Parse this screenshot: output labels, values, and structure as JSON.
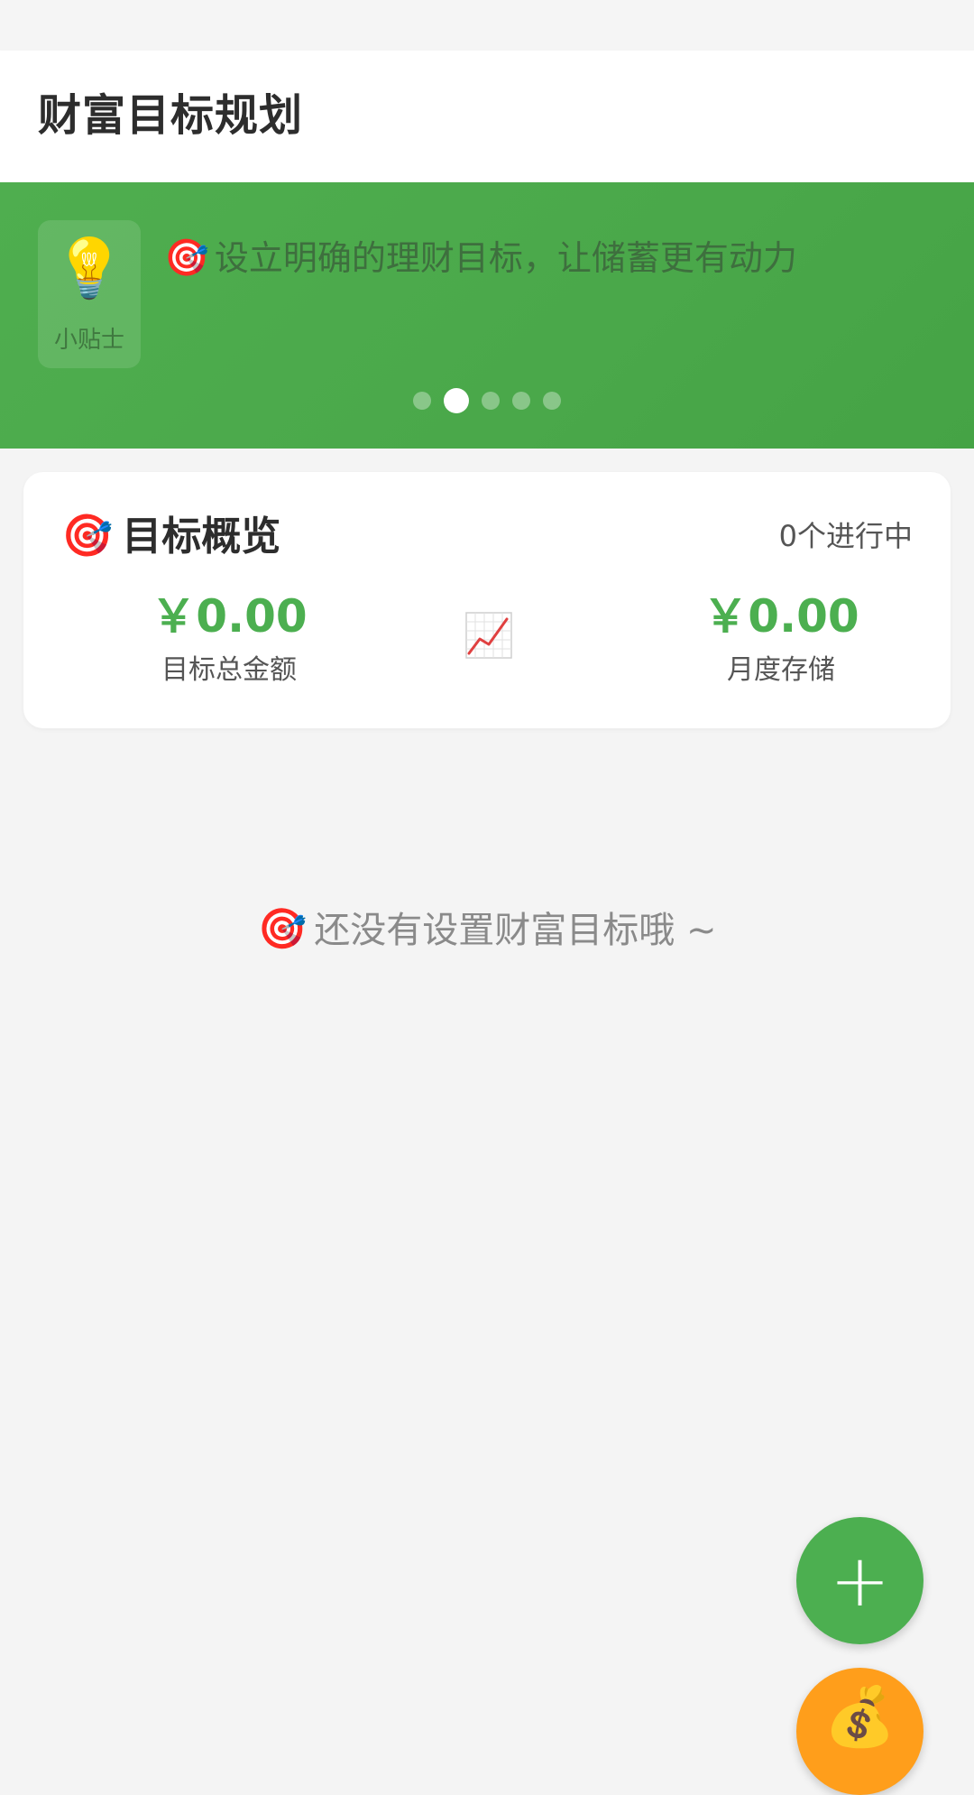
{
  "app": {
    "title": "财富目标规划"
  },
  "banner": {
    "tip_icon": "lightbulb-icon",
    "tip_glyph": "💡",
    "tip_label": "小贴士",
    "tip_text_glyph": "🎯",
    "tip_text": "设立明确的理财目标，让储蓄更有动力",
    "dots_total": 5,
    "active_dot_index": 1
  },
  "overview": {
    "title_glyph": "🎯",
    "title": "目标概览",
    "count_text": "0个进行中",
    "total_amount": "￥0.00",
    "total_label": "目标总金额",
    "monthly_amount": "￥0.00",
    "monthly_label": "月度存储",
    "chart_icon": "trend-chart-icon"
  },
  "empty_state": {
    "glyph": "🎯",
    "text": "还没有设置财富目标哦 ~"
  },
  "fab": {
    "add_glyph": "+",
    "money_icon": "money-bag-icon",
    "money_glyph": "💰"
  },
  "colors": {
    "primary": "#4caf50",
    "banner": "#4aa84a",
    "accent": "#ff9e1b",
    "background": "#f4f4f4"
  }
}
